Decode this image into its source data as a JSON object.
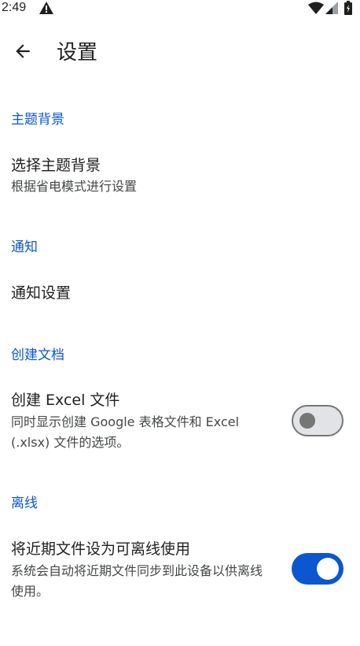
{
  "status_bar": {
    "time": "2:49",
    "icons": [
      "alert-triangle-icon",
      "wifi-icon",
      "cell-signal-icon",
      "battery-icon"
    ]
  },
  "app_bar": {
    "back_icon": "arrow-back-icon",
    "title": "设置"
  },
  "sections": {
    "theme": {
      "header": "主题背景",
      "item_title": "选择主题背景",
      "item_summary": "根据省电模式进行设置"
    },
    "notifications": {
      "header": "通知",
      "item_title": "通知设置"
    },
    "create_docs": {
      "header": "创建文档",
      "item_title": "创建 Excel 文件",
      "item_summary": "同时显示创建 Google 表格文件和 Excel (.xlsx) 文件的选项。",
      "switch_on": false
    },
    "offline": {
      "header": "离线",
      "item_title": "将近期文件设为可离线使用",
      "item_summary": "系统会自动将近期文件同步到此设备以供离线使用。",
      "switch_on": true
    }
  },
  "colors": {
    "accent": "#0b57d0",
    "text_primary": "#1f1f1f",
    "text_secondary": "#444746",
    "switch_off_track": "#e1e3e6",
    "switch_off_outline": "#747775",
    "background": "#ffffff"
  }
}
